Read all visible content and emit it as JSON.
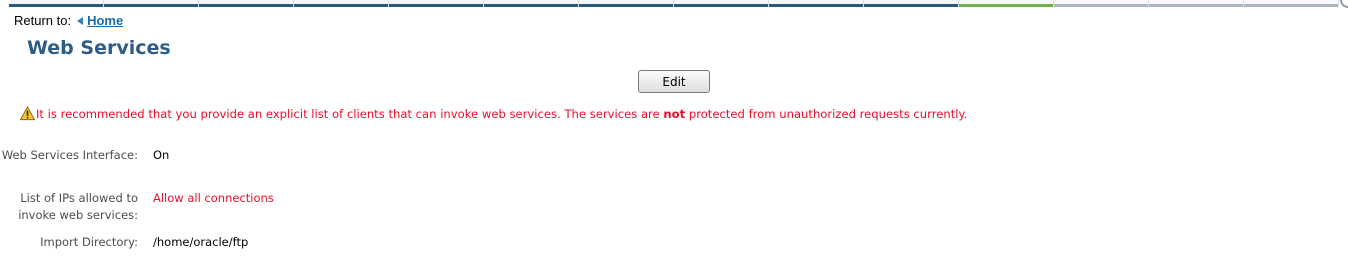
{
  "nav": {
    "return_label": "Return to:",
    "home_link": "Home"
  },
  "page": {
    "title": "Web Services"
  },
  "toolbar": {
    "edit_label": "Edit"
  },
  "warning": {
    "icon": "warning-triangle-icon",
    "text_before": "It is recommended that you provide an explicit list of clients that can invoke web services. The services are ",
    "emphasis": "not",
    "text_after": " protected from unauthorized requests currently.",
    "color": "#e3102a"
  },
  "properties": [
    {
      "label": "Web Services Interface:",
      "value": "On",
      "value_color": "#000000"
    },
    {
      "label": "List of IPs allowed to invoke web services:",
      "value": "Allow all connections",
      "value_color": "#e3102a"
    },
    {
      "label": "Import Directory:",
      "value": "/home/oracle/ftp",
      "value_color": "#000000"
    }
  ],
  "colors": {
    "title": "#2e5c86",
    "link": "#1a6aa8",
    "nav_strip": "#27587e",
    "nav_strip_active": "#6fb24a"
  }
}
